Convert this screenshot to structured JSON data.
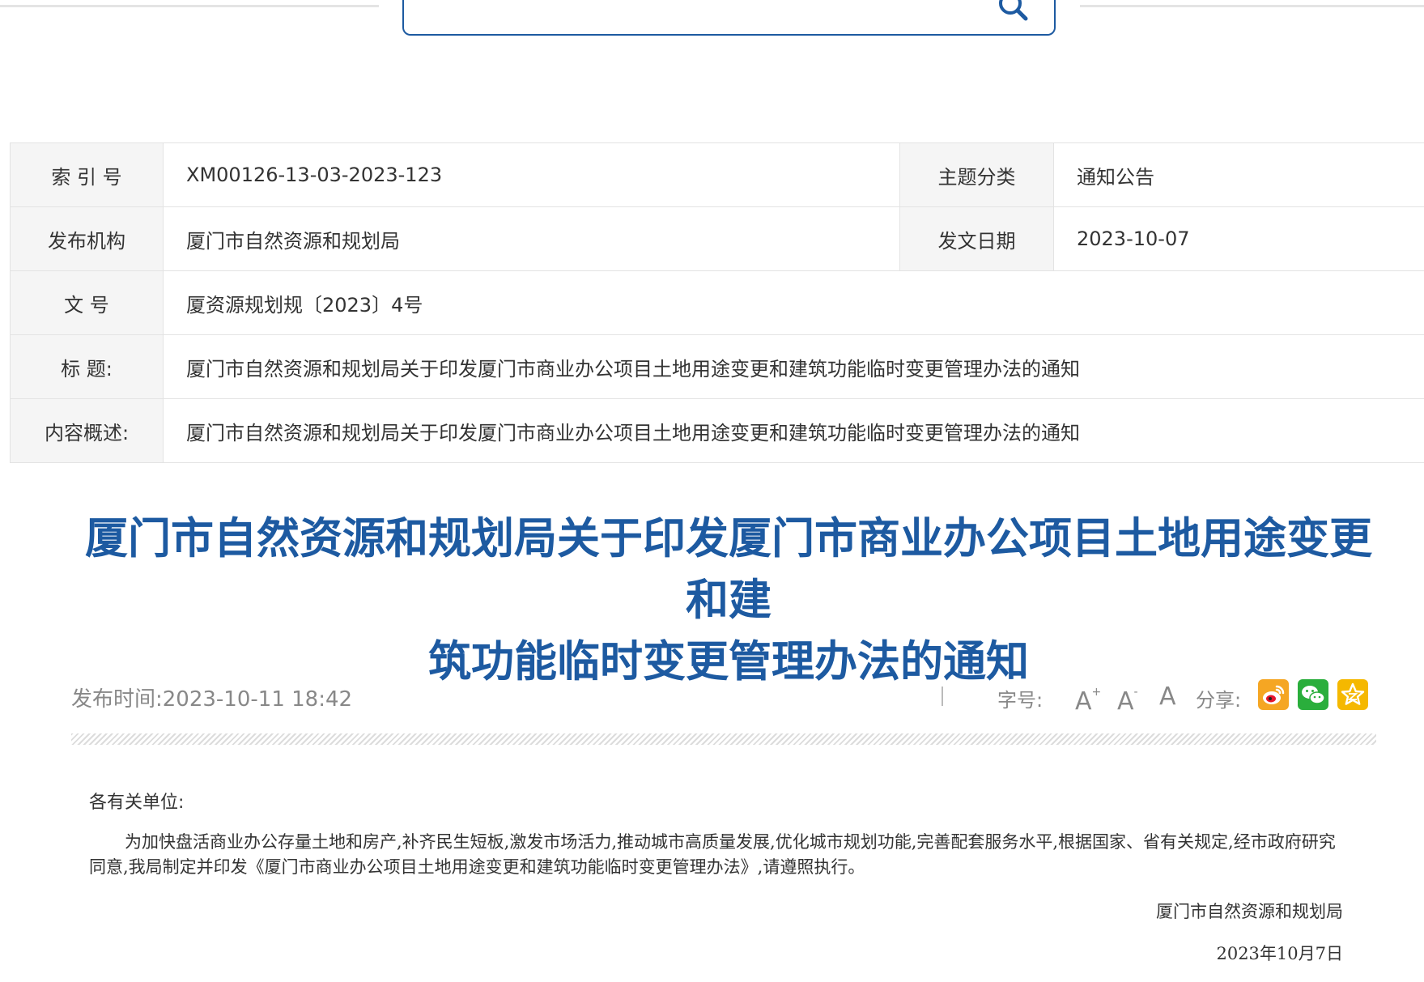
{
  "search": {
    "value": "",
    "placeholder": ""
  },
  "meta": {
    "index_label": "索 引 号",
    "index_value": "XM00126-13-03-2023-123",
    "topic_label": "主题分类",
    "topic_value": "通知公告",
    "publisher_label": "发布机构",
    "publisher_value": "厦门市自然资源和规划局",
    "date_label": "发文日期",
    "date_value": "2023-10-07",
    "docno_label": "文 号",
    "docno_value": "厦资源规划规〔2023〕4号",
    "title_label": "标 题:",
    "title_value": "厦门市自然资源和规划局关于印发厦门市商业办公项目土地用途变更和建筑功能临时变更管理办法的通知",
    "summary_label": "内容概述:",
    "summary_value": "厦门市自然资源和规划局关于印发厦门市商业办公项目土地用途变更和建筑功能临时变更管理办法的通知"
  },
  "article": {
    "title_line1": "厦门市自然资源和规划局关于印发厦门市商业办公项目土地用途变更和建",
    "title_line2": "筑功能临时变更管理办法的通知",
    "publish_time": "发布时间:2023-10-11 18:42",
    "font_size_label": "字号:",
    "font_larger": "A",
    "font_larger_mark": "+",
    "font_smaller": "A",
    "font_smaller_mark": "-",
    "font_default": "A",
    "share_label": "分享:",
    "salutation": "各有关单位:",
    "body": "为加快盘活商业办公存量土地和房产,补齐民生短板,激发市场活力,推动城市高质量发展,优化城市规划功能,完善配套服务水平,根据国家、省有关规定,经市政府研究同意,我局制定并印发《厦门市商业办公项目土地用途变更和建筑功能临时变更管理办法》,请遵照执行。",
    "signature_org": "厦门市自然资源和规划局",
    "signature_date": "2023年10月7日"
  },
  "colors": {
    "accent": "#1d5aa1",
    "weibo": "#f5a623",
    "wechat": "#2aae3c",
    "qzone": "#f5b800"
  },
  "icons": {
    "search": "search-icon",
    "weibo": "weibo-icon",
    "wechat": "wechat-icon",
    "qzone": "qzone-star-icon"
  }
}
